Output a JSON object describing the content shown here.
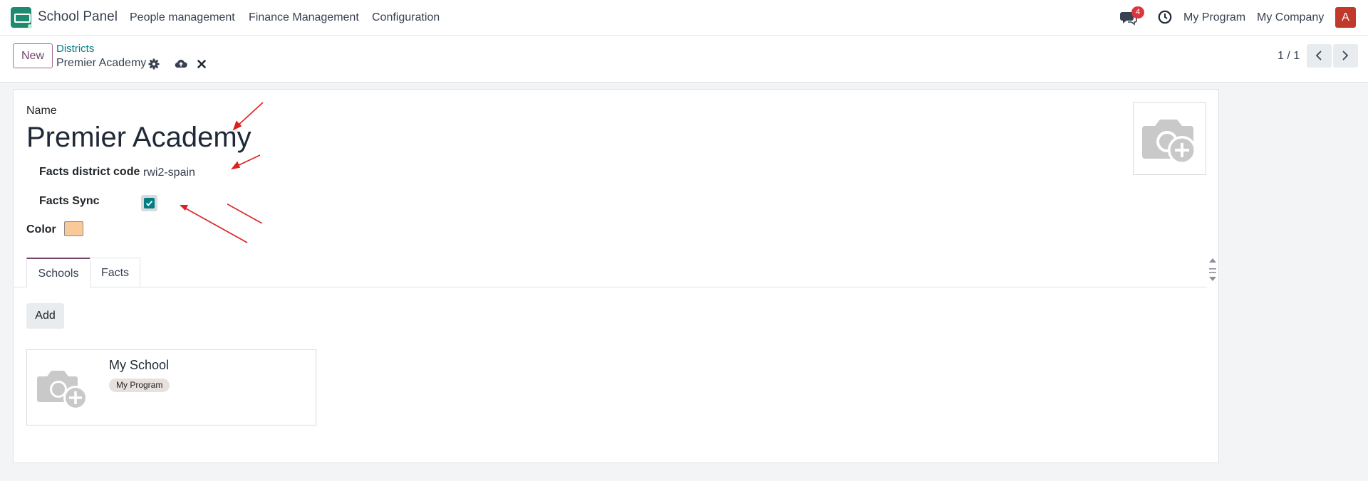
{
  "navbar": {
    "brand": "School Panel",
    "menu": [
      "People management",
      "Finance Management",
      "Configuration"
    ],
    "messages_count": "4",
    "program": "My Program",
    "company": "My Company",
    "avatar_letter": "A"
  },
  "control_panel": {
    "new_label": "New",
    "breadcrumb_parent": "Districts",
    "record_title": "Premier Academy",
    "pager": "1 / 1"
  },
  "form": {
    "name_label": "Name",
    "name_value": "Premier Academy",
    "district_code_label": "Facts district code",
    "district_code_value": "rwi2-spain",
    "facts_sync_label": "Facts Sync",
    "facts_sync_checked": true,
    "color_label": "Color",
    "color_value": "#f9c99a"
  },
  "tabs": [
    {
      "label": "Schools",
      "active": true
    },
    {
      "label": "Facts",
      "active": false
    }
  ],
  "schools": {
    "add_label": "Add",
    "cards": [
      {
        "title": "My School",
        "tag": "My Program"
      }
    ]
  },
  "colors": {
    "primary": "#71456a",
    "teal": "#017e84",
    "annotation_arrow": "#e02020"
  }
}
